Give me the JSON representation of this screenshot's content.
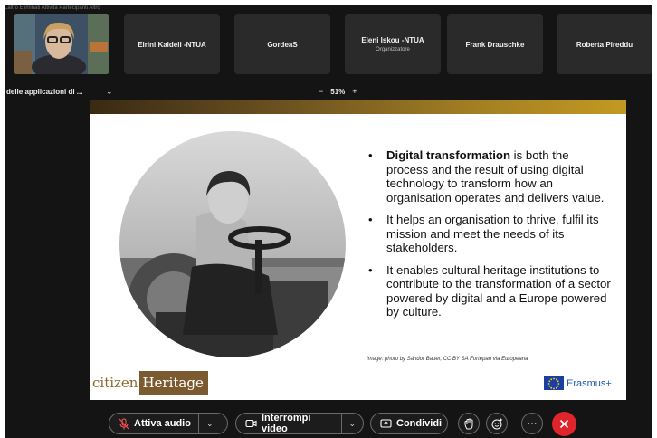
{
  "top_strip_text": "Laltro   Eliminati   Attività   Partecipanti   Altro",
  "participants": [
    {
      "name": "",
      "role": "",
      "video": true
    },
    {
      "name": "Eirini Kaldeli -NTUA",
      "role": ""
    },
    {
      "name": "GordeaS",
      "role": ""
    },
    {
      "name": "Eleni Iskou -NTUA",
      "role": "Organizzatore"
    },
    {
      "name": "Frank Drauschke",
      "role": ""
    },
    {
      "name": "Roberta Pireddu",
      "role": ""
    }
  ],
  "share": {
    "title": "delle applicazioni di ...",
    "zoom_out_label": "−",
    "zoom_value": "51%",
    "zoom_in_label": "+"
  },
  "slide": {
    "bullets": [
      {
        "bold": "Digital transformation",
        "text": " is both the process and the result of using digital technology to transform how an organisation operates and delivers value."
      },
      {
        "bold": "",
        "text": "It helps an organisation to thrive, fulfil its mission and meet the needs of its stakeholders."
      },
      {
        "bold": "",
        "text": "It enables cultural heritage institutions to contribute to the transformation of a sector powered by digital and a Europe powered by culture."
      }
    ],
    "image_credit": "Image: photo by Sándor Bauer, CC BY SA Fortepan via Europeana",
    "logo_left_a": "citizen",
    "logo_left_b": "Heritage",
    "logo_right": "Erasmus+"
  },
  "controls": {
    "audio_label": "Attiva audio",
    "video_label": "Interrompi video",
    "share_label": "Condividi",
    "more_label": "···"
  },
  "colors": {
    "background": "#141414",
    "tile": "#2a2a2a",
    "end_call": "#e0242b",
    "slide_band": "#a07d22",
    "erasmus_blue": "#1c5bb5"
  }
}
